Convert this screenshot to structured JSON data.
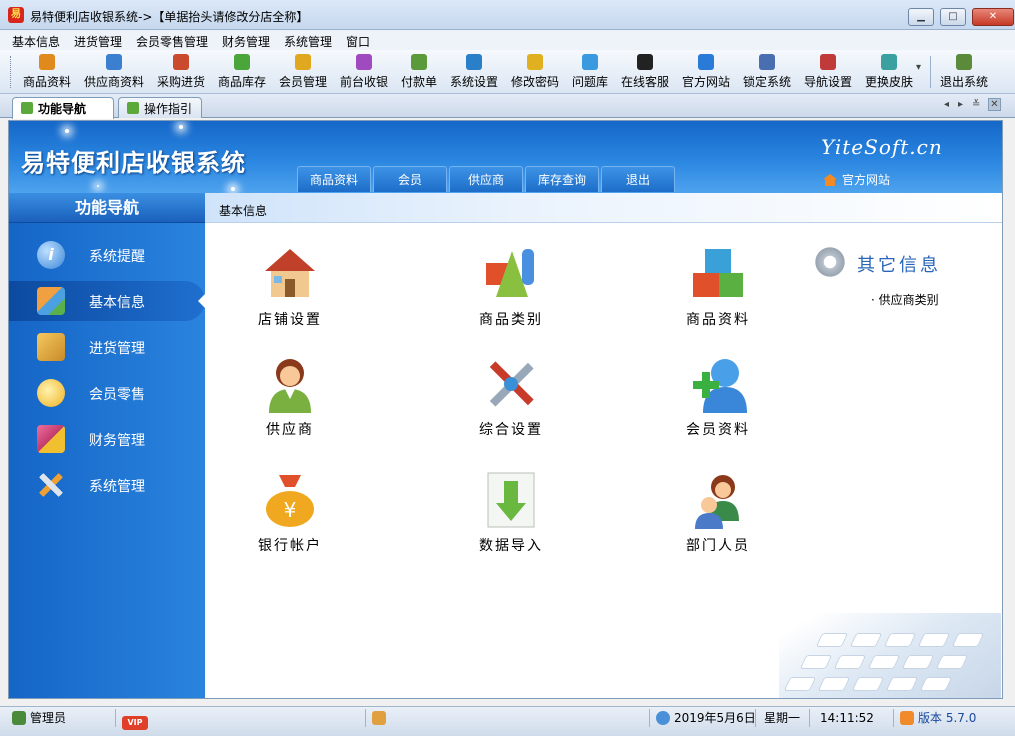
{
  "window": {
    "title": "易特便利店收银系统->【单据抬头请修改分店全称】",
    "app_icon_text": "易",
    "minimize": "▁",
    "maximize": "□",
    "close": "✕"
  },
  "menu": [
    "基本信息",
    "进货管理",
    "会员零售管理",
    "财务管理",
    "系统管理",
    "窗口"
  ],
  "toolbar": [
    {
      "label": "商品资料",
      "icon": "product-icon",
      "color": "#e08a1e"
    },
    {
      "label": "供应商资料",
      "icon": "supplier-icon",
      "color": "#3a7fd0"
    },
    {
      "label": "采购进货",
      "icon": "purchase-icon",
      "color": "#c94a2c"
    },
    {
      "label": "商品库存",
      "icon": "stock-icon",
      "color": "#4aa53a"
    },
    {
      "label": "会员管理",
      "icon": "member-icon",
      "color": "#e0a81e"
    },
    {
      "label": "前台收银",
      "icon": "cashier-icon",
      "color": "#a04ac0"
    },
    {
      "label": "付款单",
      "icon": "payment-icon",
      "color": "#5a9a3a"
    },
    {
      "label": "系统设置",
      "icon": "settings-icon",
      "color": "#2a80c8"
    },
    {
      "label": "修改密码",
      "icon": "password-icon",
      "color": "#e0b020"
    },
    {
      "label": "问题库",
      "icon": "question-icon",
      "color": "#3a9ae0"
    },
    {
      "label": "在线客服",
      "icon": "qq-icon",
      "color": "#222222"
    },
    {
      "label": "官方网站",
      "icon": "ie-icon",
      "color": "#2a7ad8"
    },
    {
      "label": "锁定系统",
      "icon": "lock-icon",
      "color": "#4a6fb0"
    },
    {
      "label": "导航设置",
      "icon": "nav-icon",
      "color": "#c03a3a"
    },
    {
      "label": "更换皮肤",
      "icon": "skin-icon",
      "color": "#3aa0a0"
    },
    {
      "label": "退出系统",
      "icon": "exit-icon",
      "color": "#5a8a3a"
    }
  ],
  "toolbar_dropdown": "▾",
  "tabs": [
    {
      "label": "功能导航",
      "active": true
    },
    {
      "label": "操作指引",
      "active": false
    }
  ],
  "tab_controls": {
    "prev": "◂",
    "next": "▸",
    "list": "≚",
    "close": "✕"
  },
  "banner": {
    "title": "易特便利店收银系统",
    "brand": "YiteSoft.cn",
    "official_site": "官方网站",
    "nav_tabs": [
      "商品资料",
      "会员",
      "供应商",
      "库存查询",
      "退出"
    ]
  },
  "sidebar": {
    "header": "功能导航",
    "items": [
      {
        "label": "系统提醒",
        "icon": "info-icon",
        "color": "#4f9ae8"
      },
      {
        "label": "基本信息",
        "icon": "cubes-icon",
        "color": "#e8602a",
        "active": true
      },
      {
        "label": "进货管理",
        "icon": "box-icon",
        "color": "#e0a02a"
      },
      {
        "label": "会员零售",
        "icon": "chat-icon",
        "color": "#f0c030"
      },
      {
        "label": "财务管理",
        "icon": "finance-icon",
        "color": "#d04a8a"
      },
      {
        "label": "系统管理",
        "icon": "tools-icon",
        "color": "#8aa0b8"
      }
    ]
  },
  "section": {
    "title": "基本信息"
  },
  "features": [
    {
      "label": "店铺设置",
      "icon": "store-icon",
      "color": "#d88a3a"
    },
    {
      "label": "商品类别",
      "icon": "category-icon",
      "color": "#e0702a"
    },
    {
      "label": "商品资料",
      "icon": "product-cubes-icon",
      "color": "#3aa0d0"
    },
    {
      "label": "供应商",
      "icon": "supplier-person-icon",
      "color": "#9a5a2a"
    },
    {
      "label": "综合设置",
      "icon": "tools-settings-icon",
      "color": "#c83a2a"
    },
    {
      "label": "会员资料",
      "icon": "member-add-icon",
      "color": "#3a90e0"
    },
    {
      "label": "银行帐户",
      "icon": "money-bag-icon",
      "color": "#f0a020"
    },
    {
      "label": "数据导入",
      "icon": "import-icon",
      "color": "#5aaa3a"
    },
    {
      "label": "部门人员",
      "icon": "staff-icon",
      "color": "#3a8a4a"
    }
  ],
  "other": {
    "title": "其它信息",
    "links": [
      "供应商类别"
    ]
  },
  "statusbar": {
    "user": "管理员",
    "vip": "VIP",
    "date": "2019年5月6日",
    "weekday": "星期一",
    "time": "14:11:52",
    "version": "版本 5.7.0"
  }
}
